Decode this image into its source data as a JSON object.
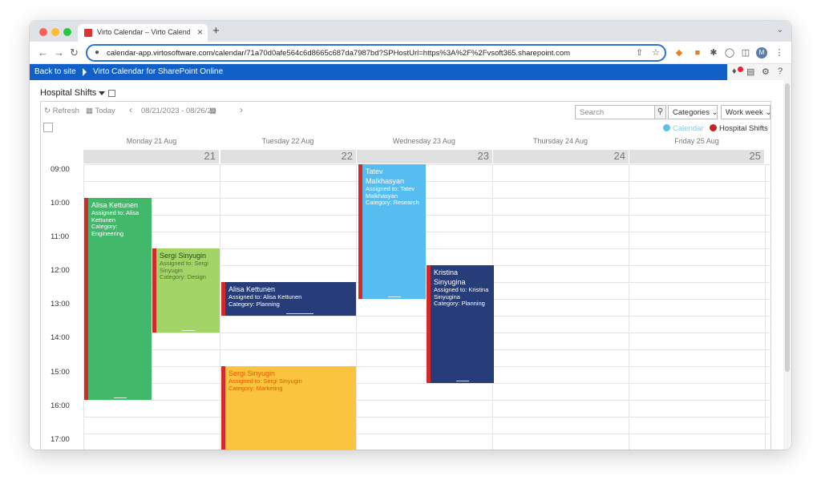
{
  "browser": {
    "tab_title": "Virto Calendar – Virto Calenda",
    "tab_close": "×",
    "new_tab": "+",
    "url": "calendar-app.virtosoftware.com/calendar/71a70d0afe564c6d8665c687da7987bd?SPHostUrl=https%3A%2F%2Fvsoft365.sharepoint.com",
    "profile_initial": "M"
  },
  "sharepoint_bar": {
    "back_label": "Back to site",
    "app_label": "Virto Calendar for SharePoint Online"
  },
  "calendar": {
    "title": "Hospital Shifts",
    "toolbar": {
      "refresh_label": "Refresh",
      "today_label": "Today",
      "date_range": "08/21/2023 - 08/26/20",
      "search_placeholder": "Search",
      "categories_label": "Categories",
      "view_label": "Work week"
    },
    "legend": [
      {
        "label": "Calendar",
        "color": "#5bc0eb"
      },
      {
        "label": "Hospital Shifts",
        "color": "#cc1f1f"
      }
    ],
    "days": [
      {
        "header": "Monday 21 Aug",
        "number": "21"
      },
      {
        "header": "Tuesday 22 Aug",
        "number": "22"
      },
      {
        "header": "Wednesday 23 Aug",
        "number": "23"
      },
      {
        "header": "Thursday 24 Aug",
        "number": "24"
      },
      {
        "header": "Friday 25 Aug",
        "number": "25"
      }
    ],
    "time_labels": [
      "09:00",
      "10:00",
      "11:00",
      "12:00",
      "13:00",
      "14:00",
      "15:00",
      "16:00",
      "17:00"
    ],
    "events": [
      {
        "title": "Alisa Kettunen",
        "assigned": "Assigned to: Alisa Kettunen",
        "category": "Category: Engineering",
        "color": "#42b86b",
        "text_color": "#ffffff"
      },
      {
        "title": "Sergi Sinyugin",
        "assigned": "Assigned to: Sergi Sinyugin",
        "category": "Category: Design",
        "color": "#a3d467",
        "text_color": "#2a4a1a"
      },
      {
        "title": "Alisa Kettunen",
        "assigned": "Assigned to: Alisa Kettunen",
        "category": "Category: Planning",
        "color": "#263d7a",
        "text_color": "#ffffff"
      },
      {
        "title": "Sergi Sinyugin",
        "assigned": "Assigned to: Sergi Sinyugin",
        "category": "Category: Marketing",
        "color": "#fbc43e",
        "text_color": "#e05a00"
      },
      {
        "title": "Tatev Malkhasyan",
        "assigned": "Assigned to: Tatev Malkhasyan",
        "category": "Category: Research",
        "color": "#55bdf0",
        "text_color": "#ffffff"
      },
      {
        "title": "Kristina Sinyugina",
        "assigned": "Assigned to: Kristina Sinyugina",
        "category": "Category: Planning",
        "color": "#263d7a",
        "text_color": "#ffffff"
      }
    ]
  }
}
